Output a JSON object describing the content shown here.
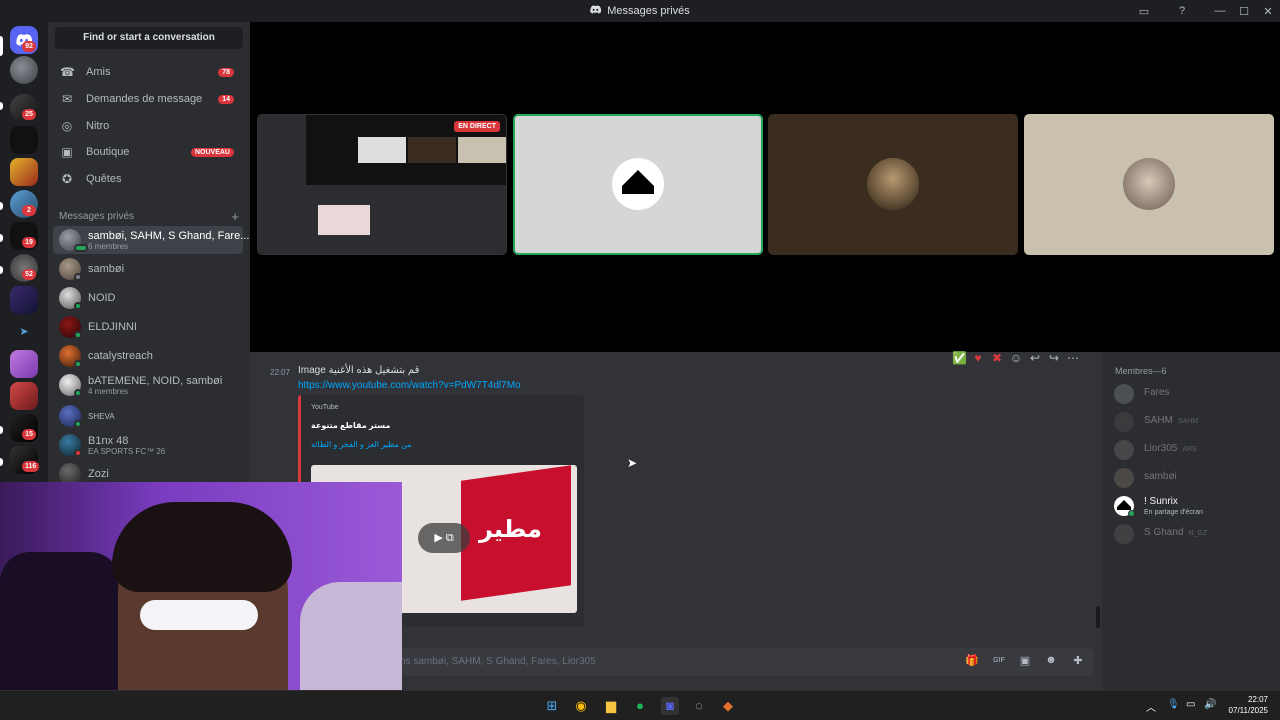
{
  "window": {
    "title": "Messages privés",
    "title_icon": "discord-icon"
  },
  "guilds": {
    "home_badge": "92",
    "items": [
      {
        "badge": "25"
      },
      {
        "badge": "2"
      },
      {
        "badge": "19"
      },
      {
        "badge": "52"
      },
      {
        "badge": "15"
      },
      {
        "badge": "116"
      }
    ]
  },
  "sidebar": {
    "search_label": "Find or start a conversation",
    "nav": [
      {
        "label": "Amis",
        "badge": "78",
        "icon": "friends-icon"
      },
      {
        "label": "Demandes de message",
        "badge": "14",
        "icon": "mail-icon"
      },
      {
        "label": "Nitro",
        "badge": "",
        "icon": "nitro-icon"
      },
      {
        "label": "Boutique",
        "badge": "NOUVEAU",
        "icon": "shop-icon"
      },
      {
        "label": "Quêtes",
        "badge": "",
        "icon": "quests-icon"
      }
    ],
    "dm_header": "Messages privés",
    "dms": [
      {
        "name": "sambøi, SAHM, S Ghand, Fare...",
        "sub": "6 membres"
      },
      {
        "name": "sambøi",
        "sub": ""
      },
      {
        "name": "NOID",
        "sub": ""
      },
      {
        "name": "ELDJINNI",
        "sub": ""
      },
      {
        "name": "catalystreach",
        "sub": ""
      },
      {
        "name": "bATEMENE, NOID, sambøi",
        "sub": "4 membres"
      },
      {
        "name": "SHEVA",
        "sub": ""
      },
      {
        "name": "B1nx 48",
        "sub": "EA SPORTS FC™ 26"
      },
      {
        "name": "Zozi",
        "sub": ""
      }
    ]
  },
  "stage": {
    "live_label": "EN DIRECT"
  },
  "message": {
    "time": "22:07",
    "text": "Image قم بتشغيل هذه الأغنية",
    "link": "https://www.youtube.com/watch?v=PdW7T4dl7Mo",
    "embed": {
      "provider": "YouTube",
      "title": "مستر مقاطع متنوعة",
      "description": "من مطير العز و الفخر و الطائه",
      "thumb_text": "مطير"
    }
  },
  "input": {
    "placeholder": "ns sambøi, SAHM, S Ghand, Fares, Lior305"
  },
  "members": {
    "header": "Membres—6",
    "list": [
      {
        "name": "Fares",
        "tag": "",
        "sub": ""
      },
      {
        "name": "SAHM",
        "tag": "SAHM",
        "sub": ""
      },
      {
        "name": "Lior305",
        "tag": "ARS",
        "sub": ""
      },
      {
        "name": "sambøi",
        "tag": "",
        "sub": ""
      },
      {
        "name": "! Sunrix",
        "tag": "",
        "sub": "En partage d'écran"
      },
      {
        "name": "S Ghand",
        "tag": "N_GZ",
        "sub": ""
      }
    ]
  },
  "taskbar": {
    "time": "22:07",
    "date": "07/11/2025"
  },
  "colors": {
    "accent": "#5865f2",
    "danger": "#da373c",
    "online": "#23a55a",
    "link": "#00a8fc"
  }
}
